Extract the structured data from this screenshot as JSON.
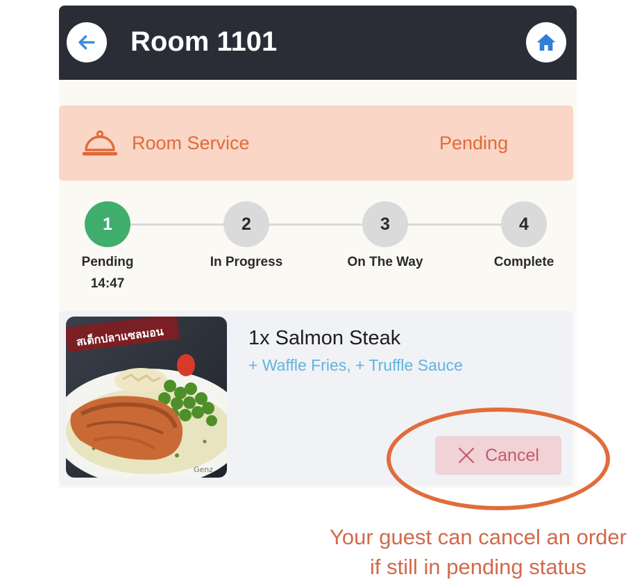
{
  "header": {
    "title": "Room 1101",
    "back_icon": "arrow-left-icon",
    "home_icon": "home-icon"
  },
  "service": {
    "icon": "cloche-icon",
    "label": "Room Service",
    "status": "Pending"
  },
  "steps": [
    {
      "number": "1",
      "label": "Pending",
      "time": "14:47",
      "active": true
    },
    {
      "number": "2",
      "label": "In Progress",
      "time": "",
      "active": false
    },
    {
      "number": "3",
      "label": "On The Way",
      "time": "",
      "active": false
    },
    {
      "number": "4",
      "label": "Complete",
      "time": "",
      "active": false
    }
  ],
  "order": {
    "item": "1x Salmon Steak",
    "addons": "+ Waffle Fries, + Truffle Sauce",
    "image_caption": "สเต็กปลาแซลมอน",
    "image_watermark": "Genz",
    "cancel_label": "Cancel",
    "cancel_icon": "close-icon"
  },
  "annotation": {
    "line1": "Your guest can cancel an order",
    "line2": "if still in pending status"
  },
  "colors": {
    "header_bg": "#2a2d35",
    "accent_orange": "#e16a3a",
    "banner_bg": "#f9d6c6",
    "step_active": "#3fae6c",
    "addon_blue": "#61b3e0",
    "cancel_bg": "#f1d2d6",
    "annotation": "#d2694a"
  }
}
